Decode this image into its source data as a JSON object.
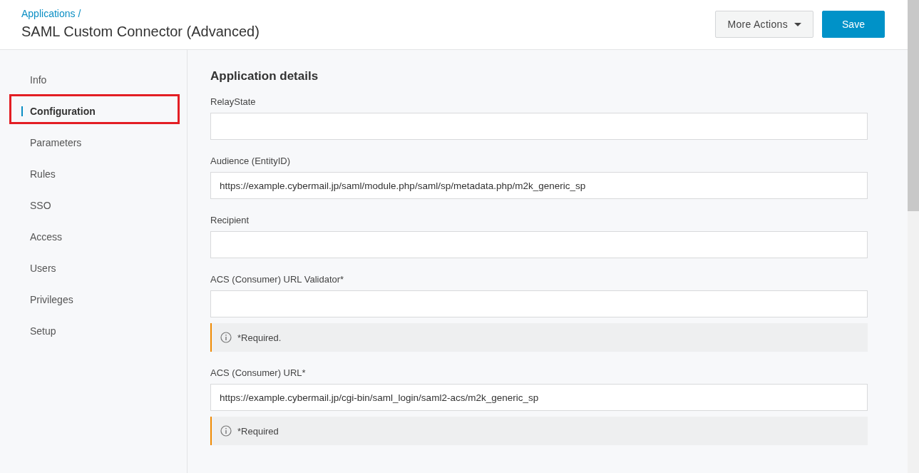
{
  "header": {
    "breadcrumb": "Applications /",
    "title": "SAML Custom Connector (Advanced)",
    "buttons": [
      {
        "kind": "dropdown",
        "label": "More Actions"
      },
      {
        "kind": "primary",
        "label": "Save"
      }
    ]
  },
  "sidebar": {
    "items": [
      {
        "label": "Info",
        "selected": false,
        "highlighted": false
      },
      {
        "label": "Configuration",
        "selected": true,
        "highlighted": true
      },
      {
        "label": "Parameters",
        "selected": false,
        "highlighted": false
      },
      {
        "label": "Rules",
        "selected": false,
        "highlighted": false
      },
      {
        "label": "SSO",
        "selected": false,
        "highlighted": false
      },
      {
        "label": "Access",
        "selected": false,
        "highlighted": false
      },
      {
        "label": "Users",
        "selected": false,
        "highlighted": false
      },
      {
        "label": "Privileges",
        "selected": false,
        "highlighted": false
      },
      {
        "label": "Setup",
        "selected": false,
        "highlighted": false
      }
    ]
  },
  "section": {
    "title": "Application details",
    "fields": [
      {
        "label": "RelayState"
      },
      {
        "label": "Audience (EntityID)",
        "value": "https://example.cybermail.jp/saml/module.php/saml/sp/metadata.php/m2k_generic_sp"
      },
      {
        "label": "Recipient"
      },
      {
        "label": "ACS (Consumer) URL Validator*",
        "note": "*Required."
      },
      {
        "label": "ACS (Consumer) URL*",
        "value": "https://example.cybermail.jp/cgi-bin/saml_login/saml2-acs/m2k_generic_sp",
        "note": "*Required"
      }
    ]
  }
}
